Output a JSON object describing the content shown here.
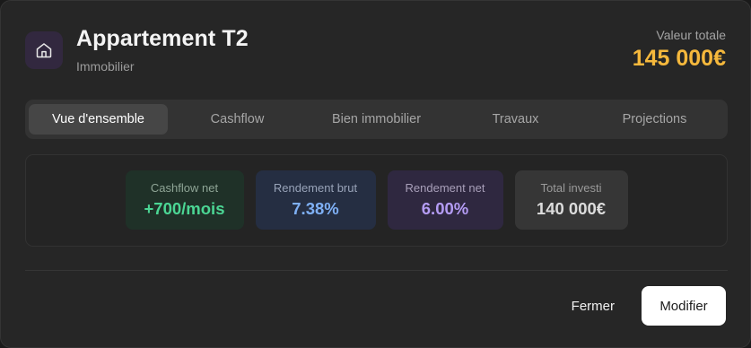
{
  "header": {
    "title": "Appartement T2",
    "subtitle": "Immobilier",
    "icon": "home-icon",
    "value_label": "Valeur totale",
    "value_amount": "145 000€"
  },
  "tabs": [
    {
      "label": "Vue d'ensemble",
      "active": true
    },
    {
      "label": "Cashflow",
      "active": false
    },
    {
      "label": "Bien immobilier",
      "active": false
    },
    {
      "label": "Travaux",
      "active": false
    },
    {
      "label": "Projections",
      "active": false
    }
  ],
  "stats": [
    {
      "label": "Cashflow net",
      "value": "+700/mois",
      "color": "#4bd694"
    },
    {
      "label": "Rendement brut",
      "value": "7.38%",
      "color": "#7fb0f5"
    },
    {
      "label": "Rendement net",
      "value": "6.00%",
      "color": "#b49cf4"
    },
    {
      "label": "Total investi",
      "value": "140 000€",
      "color": "#dcdcdc"
    }
  ],
  "footer": {
    "close_label": "Fermer",
    "edit_label": "Modifier"
  },
  "colors": {
    "accent_gold": "#f5b83c",
    "background": "#262626"
  }
}
